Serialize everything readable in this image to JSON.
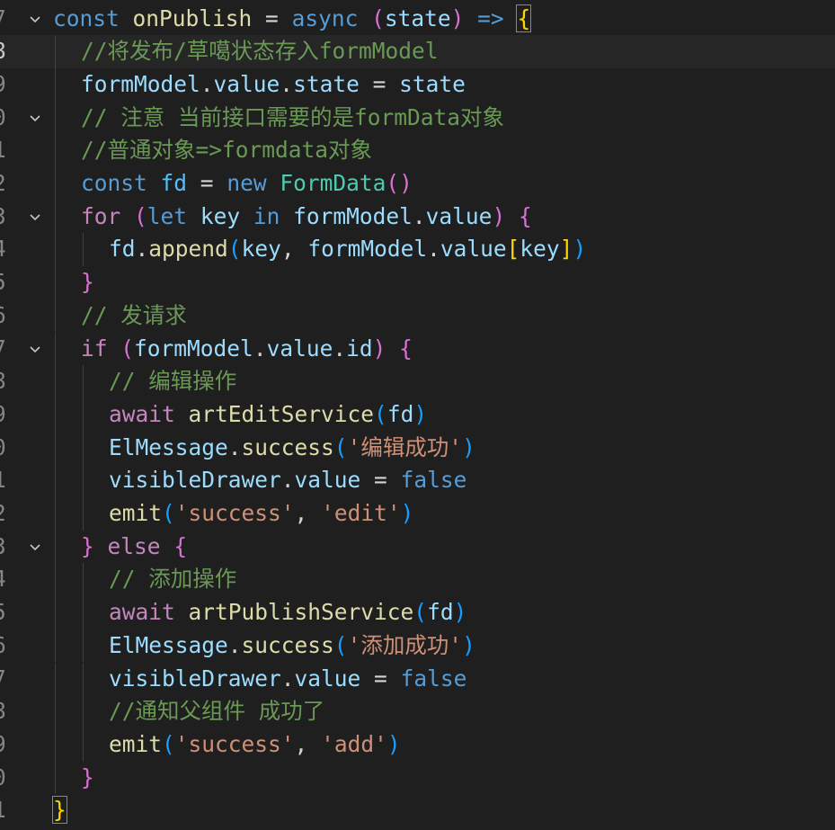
{
  "editor": {
    "colors": {
      "background": "#1f1f1f",
      "current_line": "#262626",
      "keyword": "#569cd6",
      "control": "#c586c0",
      "function": "#dcdcaa",
      "variable": "#9cdcfe",
      "string": "#ce9178",
      "comment": "#6a9955",
      "class": "#4ec9b0"
    },
    "fold_icon": "chevron-down-icon",
    "lines": [
      {
        "n": "7",
        "fold": true,
        "indent": 0,
        "tokens": [
          [
            "const",
            "kw"
          ],
          [
            " ",
            "op"
          ],
          [
            "onPublish",
            "fn"
          ],
          [
            " = ",
            "op"
          ],
          [
            "async",
            "kw"
          ],
          [
            " ",
            "op"
          ],
          [
            "(",
            "p2"
          ],
          [
            "state",
            "var"
          ],
          [
            ")",
            "p2"
          ],
          [
            " ",
            "op"
          ],
          [
            "=>",
            "kw"
          ],
          [
            " ",
            "op"
          ],
          [
            "{",
            "p1hl"
          ]
        ]
      },
      {
        "n": "8",
        "current": true,
        "indent": 1,
        "tokens": [
          [
            "//将发布/草噶状态存入formModel",
            "cm"
          ]
        ]
      },
      {
        "n": "9",
        "indent": 1,
        "tokens": [
          [
            "formModel",
            "var"
          ],
          [
            ".",
            "op"
          ],
          [
            "value",
            "var"
          ],
          [
            ".",
            "op"
          ],
          [
            "state",
            "var"
          ],
          [
            " = ",
            "op"
          ],
          [
            "state",
            "var"
          ]
        ]
      },
      {
        "n": "0",
        "fold": true,
        "indent": 1,
        "tokens": [
          [
            "// 注意 当前接口需要的是formData对象",
            "cm"
          ]
        ]
      },
      {
        "n": "1",
        "indent": 1,
        "tokens": [
          [
            "//普通对象=>formdata对象",
            "cm"
          ]
        ]
      },
      {
        "n": "2",
        "indent": 1,
        "tokens": [
          [
            "const",
            "kw"
          ],
          [
            " ",
            "op"
          ],
          [
            "fd",
            "const"
          ],
          [
            " = ",
            "op"
          ],
          [
            "new",
            "kw"
          ],
          [
            " ",
            "op"
          ],
          [
            "FormData",
            "cls"
          ],
          [
            "()",
            "p2"
          ]
        ]
      },
      {
        "n": "3",
        "fold": true,
        "indent": 1,
        "tokens": [
          [
            "for",
            "ctrl"
          ],
          [
            " ",
            "op"
          ],
          [
            "(",
            "p2"
          ],
          [
            "let",
            "kw"
          ],
          [
            " ",
            "op"
          ],
          [
            "key",
            "var"
          ],
          [
            " ",
            "op"
          ],
          [
            "in",
            "kw"
          ],
          [
            " ",
            "op"
          ],
          [
            "formModel",
            "var"
          ],
          [
            ".",
            "op"
          ],
          [
            "value",
            "var"
          ],
          [
            ")",
            "p2"
          ],
          [
            " ",
            "op"
          ],
          [
            "{",
            "p2"
          ]
        ]
      },
      {
        "n": "4",
        "indent": 2,
        "tokens": [
          [
            "fd",
            "var"
          ],
          [
            ".",
            "op"
          ],
          [
            "append",
            "fn"
          ],
          [
            "(",
            "p3"
          ],
          [
            "key",
            "var"
          ],
          [
            ", ",
            "op"
          ],
          [
            "formModel",
            "var"
          ],
          [
            ".",
            "op"
          ],
          [
            "value",
            "var"
          ],
          [
            "[",
            "p1"
          ],
          [
            "key",
            "var"
          ],
          [
            "]",
            "p1"
          ],
          [
            ")",
            "p3"
          ]
        ]
      },
      {
        "n": "5",
        "indent": 1,
        "tokens": [
          [
            "}",
            "p2"
          ]
        ]
      },
      {
        "n": "6",
        "indent": 1,
        "tokens": [
          [
            "// 发请求",
            "cm"
          ]
        ]
      },
      {
        "n": "7",
        "fold": true,
        "indent": 1,
        "tokens": [
          [
            "if",
            "ctrl"
          ],
          [
            " ",
            "op"
          ],
          [
            "(",
            "p2"
          ],
          [
            "formModel",
            "var"
          ],
          [
            ".",
            "op"
          ],
          [
            "value",
            "var"
          ],
          [
            ".",
            "op"
          ],
          [
            "id",
            "var"
          ],
          [
            ")",
            "p2"
          ],
          [
            " ",
            "op"
          ],
          [
            "{",
            "p2"
          ]
        ]
      },
      {
        "n": "8",
        "indent": 2,
        "tokens": [
          [
            "// 编辑操作",
            "cm"
          ]
        ]
      },
      {
        "n": "9",
        "indent": 2,
        "tokens": [
          [
            "await",
            "ctrl"
          ],
          [
            " ",
            "op"
          ],
          [
            "artEditService",
            "fn"
          ],
          [
            "(",
            "p3"
          ],
          [
            "fd",
            "var"
          ],
          [
            ")",
            "p3"
          ]
        ]
      },
      {
        "n": "0",
        "indent": 2,
        "tokens": [
          [
            "ElMessage",
            "var"
          ],
          [
            ".",
            "op"
          ],
          [
            "success",
            "fn"
          ],
          [
            "(",
            "p3"
          ],
          [
            "'编辑成功'",
            "str"
          ],
          [
            ")",
            "p3"
          ]
        ]
      },
      {
        "n": "1",
        "indent": 2,
        "tokens": [
          [
            "visibleDrawer",
            "var"
          ],
          [
            ".",
            "op"
          ],
          [
            "value",
            "var"
          ],
          [
            " = ",
            "op"
          ],
          [
            "false",
            "kw"
          ]
        ]
      },
      {
        "n": "2",
        "indent": 2,
        "tokens": [
          [
            "emit",
            "fn"
          ],
          [
            "(",
            "p3"
          ],
          [
            "'success'",
            "str"
          ],
          [
            ", ",
            "op"
          ],
          [
            "'edit'",
            "str"
          ],
          [
            ")",
            "p3"
          ]
        ]
      },
      {
        "n": "3",
        "fold": true,
        "indent": 1,
        "tokens": [
          [
            "}",
            "p2"
          ],
          [
            " ",
            "op"
          ],
          [
            "else",
            "ctrl"
          ],
          [
            " ",
            "op"
          ],
          [
            "{",
            "p2"
          ]
        ]
      },
      {
        "n": "4",
        "indent": 2,
        "tokens": [
          [
            "// 添加操作",
            "cm"
          ]
        ]
      },
      {
        "n": "5",
        "indent": 2,
        "tokens": [
          [
            "await",
            "ctrl"
          ],
          [
            " ",
            "op"
          ],
          [
            "artPublishService",
            "fn"
          ],
          [
            "(",
            "p3"
          ],
          [
            "fd",
            "var"
          ],
          [
            ")",
            "p3"
          ]
        ]
      },
      {
        "n": "6",
        "indent": 2,
        "tokens": [
          [
            "ElMessage",
            "var"
          ],
          [
            ".",
            "op"
          ],
          [
            "success",
            "fn"
          ],
          [
            "(",
            "p3"
          ],
          [
            "'添加成功'",
            "str"
          ],
          [
            ")",
            "p3"
          ]
        ]
      },
      {
        "n": "7",
        "indent": 2,
        "tokens": [
          [
            "visibleDrawer",
            "var"
          ],
          [
            ".",
            "op"
          ],
          [
            "value",
            "var"
          ],
          [
            " = ",
            "op"
          ],
          [
            "false",
            "kw"
          ]
        ]
      },
      {
        "n": "8",
        "indent": 2,
        "tokens": [
          [
            "//通知父组件 成功了",
            "cm"
          ]
        ]
      },
      {
        "n": "9",
        "indent": 2,
        "tokens": [
          [
            "emit",
            "fn"
          ],
          [
            "(",
            "p3"
          ],
          [
            "'success'",
            "str"
          ],
          [
            ", ",
            "op"
          ],
          [
            "'add'",
            "str"
          ],
          [
            ")",
            "p3"
          ]
        ]
      },
      {
        "n": "0",
        "indent": 1,
        "tokens": [
          [
            "}",
            "p2"
          ]
        ]
      },
      {
        "n": "1",
        "indent": 0,
        "tokens": [
          [
            "}",
            "p1hl"
          ]
        ]
      }
    ]
  }
}
